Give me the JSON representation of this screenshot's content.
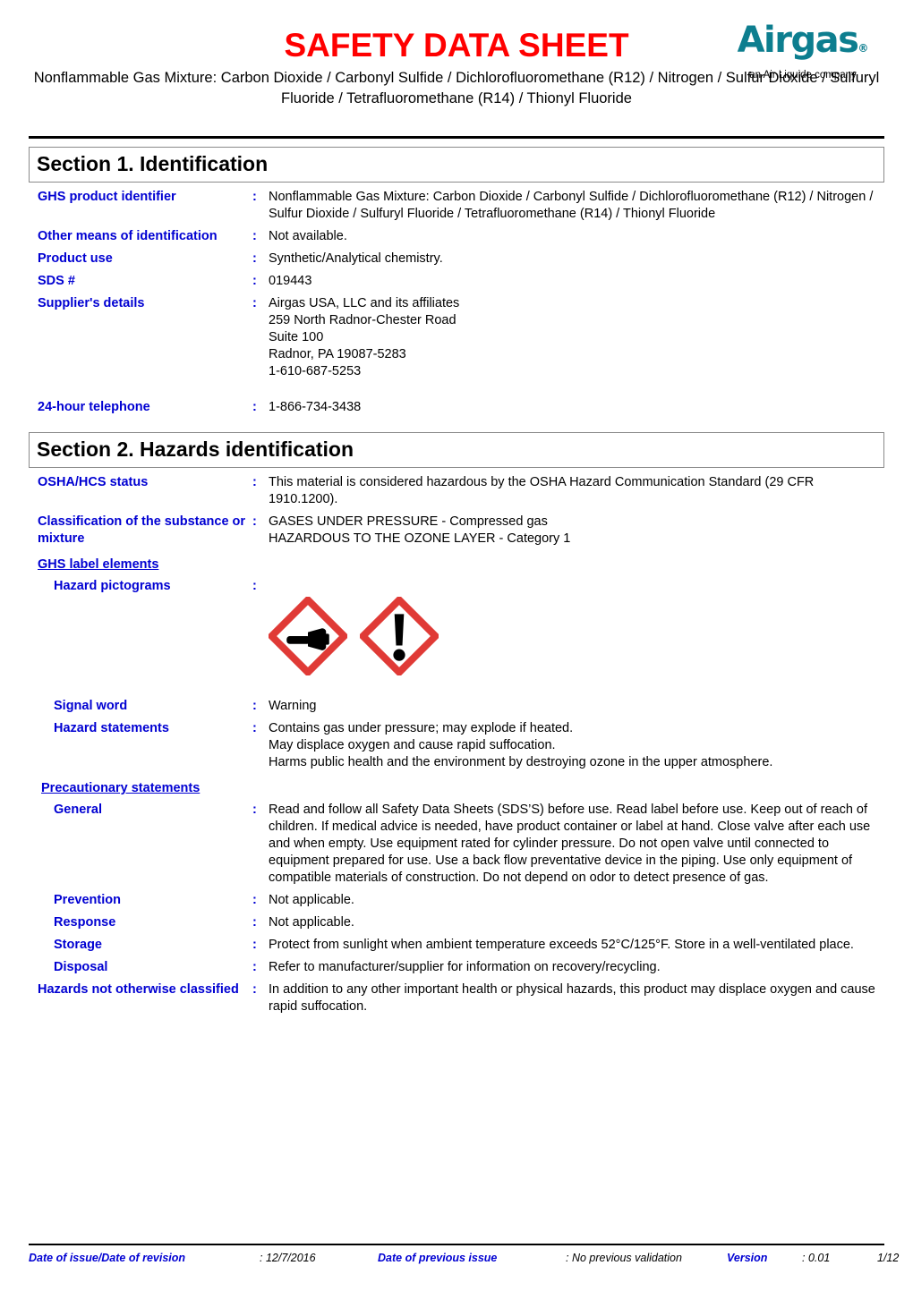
{
  "header": {
    "title": "SAFETY DATA SHEET",
    "subtitle": "Nonflammable Gas Mixture:  Carbon Dioxide / Carbonyl Sulfide /\nDichlorofluoromethane (R12) / Nitrogen / Sulfur Dioxide / Sulfuryl Fluoride /\nTetrafluoromethane (R14) / Thionyl Fluoride",
    "logo_word": "Airgas",
    "logo_registered": "®",
    "logo_tagline": "an Air Liquide company",
    "title_color": "#ff0000",
    "logo_color": "#0d7e8f"
  },
  "section1": {
    "title": "Section 1. Identification",
    "rows": [
      {
        "label": "GHS product identifier",
        "colon": ":",
        "value": "Nonflammable Gas Mixture:  Carbon Dioxide / Carbonyl Sulfide / Dichlorofluoromethane (R12) / Nitrogen / Sulfur Dioxide / Sulfuryl Fluoride / Tetrafluoromethane (R14) / Thionyl Fluoride"
      },
      {
        "label": "Other means of identification",
        "colon": ":",
        "value": "Not available."
      },
      {
        "label": "Product use",
        "colon": ":",
        "value": "Synthetic/Analytical chemistry."
      },
      {
        "label": "SDS #",
        "colon": ":",
        "value": "019443"
      },
      {
        "label": "Supplier's details",
        "colon": ":",
        "value": "Airgas USA, LLC and its affiliates\n259 North Radnor-Chester Road\nSuite 100\nRadnor, PA 19087-5283\n1-610-687-5253"
      },
      {
        "label": "24-hour telephone",
        "colon": ":",
        "value": "1-866-734-3438"
      }
    ]
  },
  "section2": {
    "title": "Section 2. Hazards identification",
    "osha": {
      "label": "OSHA/HCS status",
      "colon": ":",
      "value": "This material is considered hazardous by the OSHA Hazard Communication Standard (29 CFR 1910.1200)."
    },
    "classification": {
      "label": "Classification of the substance or mixture",
      "colon": ":",
      "value": "GASES UNDER PRESSURE - Compressed gas\nHAZARDOUS TO THE OZONE LAYER - Category 1"
    },
    "ghs_label_elements_heading": "GHS label elements",
    "pictograms": {
      "label": "Hazard pictograms",
      "colon": ":",
      "items": [
        "gas-cylinder-pictogram",
        "exclamation-mark-pictogram"
      ],
      "border_color": "#e03a36"
    },
    "signal_word": {
      "label": "Signal word",
      "colon": ":",
      "value": "Warning"
    },
    "hazard_statements": {
      "label": "Hazard statements",
      "colon": ":",
      "value": "Contains gas under pressure; may explode if heated.\nMay displace oxygen and cause rapid suffocation.\nHarms public health and the environment by destroying ozone in the upper atmosphere."
    },
    "precautionary_heading": "Precautionary statements",
    "precautionary_rows": [
      {
        "label": "General",
        "colon": ":",
        "value": "Read and follow all Safety Data Sheets (SDS’S) before use.  Read label before use.  Keep out of reach of children.  If medical advice is needed, have product container or label at hand.  Close valve after each use and when empty.  Use equipment rated for cylinder pressure.  Do not open valve until connected to equipment prepared for use.  Use a back flow preventative device in the piping.  Use only equipment of compatible materials of construction.  Do not depend on odor to detect presence of gas."
      },
      {
        "label": "Prevention",
        "colon": ":",
        "value": "Not applicable."
      },
      {
        "label": "Response",
        "colon": ":",
        "value": "Not applicable."
      },
      {
        "label": "Storage",
        "colon": ":",
        "value": "Protect from sunlight when ambient temperature exceeds 52°C/125°F.  Store in a well-ventilated place."
      },
      {
        "label": "Disposal",
        "colon": ":",
        "value": "Refer to manufacturer/supplier for information on recovery/recycling."
      }
    ],
    "hnoc": {
      "label": "Hazards not otherwise classified",
      "colon": ":",
      "value": "In addition to any other important health or physical hazards, this product may displace oxygen and cause rapid suffocation."
    }
  },
  "footer": {
    "date_of_issue_label": "Date of issue/Date of revision",
    "date_of_issue_value": ": 12/7/2016",
    "previous_issue_label": "Date of previous issue",
    "previous_issue_value": ": No previous validation",
    "version_label": "Version",
    "version_value": ": 0.01",
    "page": "1/12"
  }
}
